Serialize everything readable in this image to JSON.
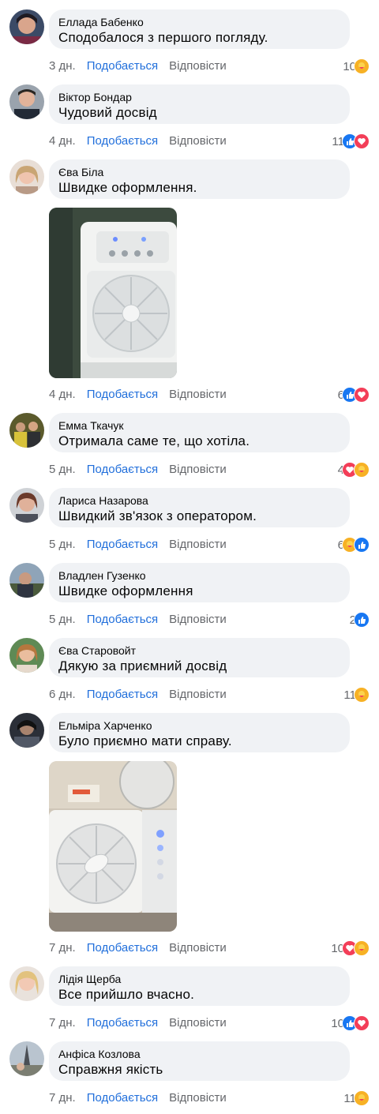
{
  "labels": {
    "like": "Подобається",
    "reply": "Відповісти"
  },
  "comments": [
    {
      "author": "Еллада Бабенко",
      "text": "Сподобалося з першого погляду.",
      "time": "3 дн.",
      "count": "10",
      "reactions": [
        "care"
      ]
    },
    {
      "author": "Віктор Бондар",
      "text": "Чудовий досвід",
      "time": "4 дн.",
      "count": "11",
      "reactions": [
        "like",
        "love"
      ]
    },
    {
      "author": "Єва Біла",
      "text": "Швидке оформлення.",
      "time": "4 дн.",
      "count": "6",
      "reactions": [
        "like",
        "love"
      ]
    },
    {
      "author": "Емма Ткачук",
      "text": "Отримала саме те, що хотіла.",
      "time": "5 дн.",
      "count": "4",
      "reactions": [
        "love",
        "care"
      ]
    },
    {
      "author": "Лариса Назарова",
      "text": "Швидкий зв'язок з оператором.",
      "time": "5 дн.",
      "count": "6",
      "reactions": [
        "care",
        "like"
      ]
    },
    {
      "author": "Владлен Гузенко",
      "text": "Швидке оформлення",
      "time": "5 дн.",
      "count": "2",
      "reactions": [
        "like"
      ]
    },
    {
      "author": "Єва Старовойт",
      "text": "Дякую за приємний досвід",
      "time": "6 дн.",
      "count": "11",
      "reactions": [
        "care"
      ]
    },
    {
      "author": "Ельміра Харченко",
      "text": "Було приємно мати справу.",
      "time": "7 дн.",
      "count": "10",
      "reactions": [
        "love",
        "care"
      ]
    },
    {
      "author": "Лідія Щерба",
      "text": "Все прийшло вчасно.",
      "time": "7 дн.",
      "count": "10",
      "reactions": [
        "like",
        "love"
      ]
    },
    {
      "author": "Анфіса Козлова",
      "text": "Справжня якість",
      "time": "7 дн.",
      "count": "11",
      "reactions": [
        "care"
      ]
    }
  ],
  "colors": {
    "link": "#216fdb",
    "meta": "#65676b",
    "bubble": "#f0f2f5",
    "like": "#1877f2",
    "love": "#f33e58",
    "care": "#f7b125"
  },
  "icons": {
    "like": "thumbs-up-icon",
    "love": "heart-icon",
    "care": "care-hug-icon"
  }
}
